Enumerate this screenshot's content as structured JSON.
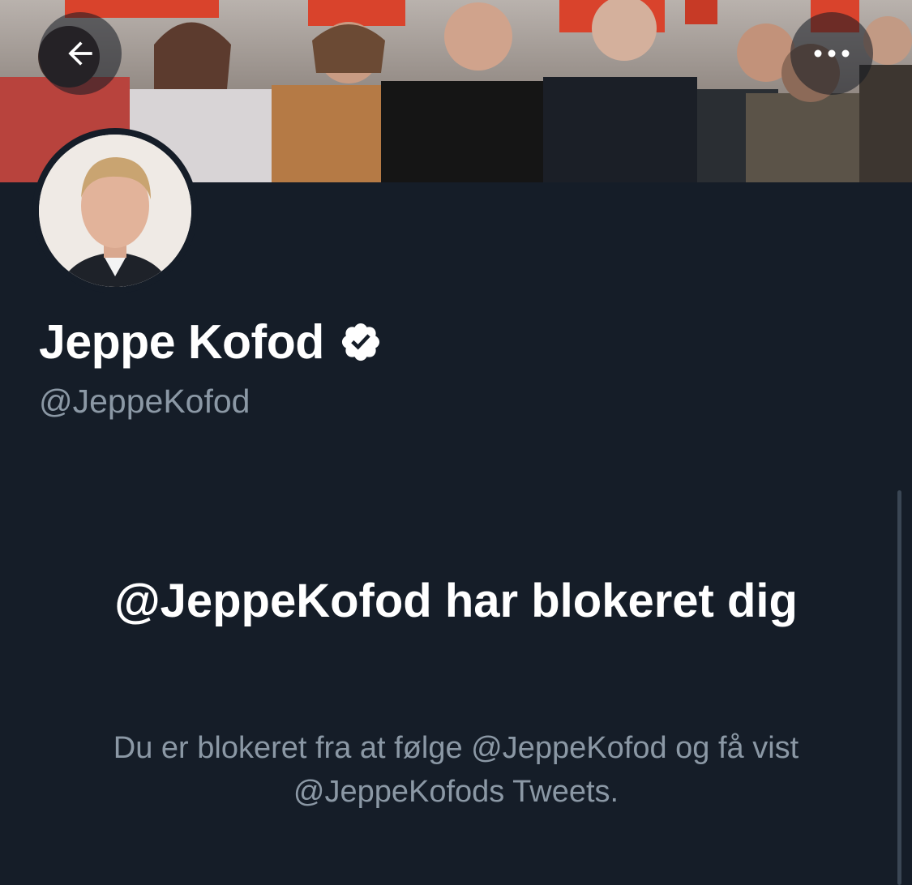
{
  "header": {
    "back_icon": "arrow-left-icon",
    "more_icon": "more-horizontal-icon"
  },
  "profile": {
    "display_name": "Jeppe Kofod",
    "verified_icon": "verified-badge-icon",
    "handle": "@JeppeKofod"
  },
  "blocked": {
    "title": "@JeppeKofod har blokeret dig",
    "description": "Du er blokeret fra at følge @JeppeKofod og få vist @JeppeKofods Tweets."
  },
  "colors": {
    "background": "#151d28",
    "primary_text": "#ffffff",
    "secondary_text": "#8b98a5",
    "banner_accent": "#d9432c"
  }
}
